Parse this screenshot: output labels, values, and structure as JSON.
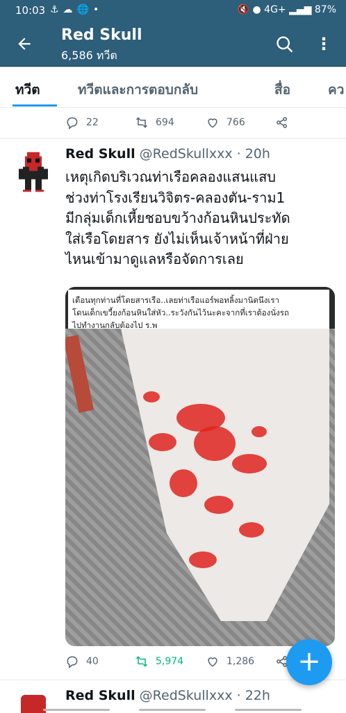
{
  "status_bar": {
    "time": "10:03",
    "left_icons": [
      "anchor-icon",
      "cloud-icon",
      "globe-icon",
      "dot-icon"
    ],
    "battery": "87%",
    "network": "4G+"
  },
  "header": {
    "title": "Red Skull",
    "subtitle": "6,586 ทวีต",
    "background": "#2d5e7a"
  },
  "tabs": [
    {
      "label": "ทวีต",
      "active": true
    },
    {
      "label": "ทวีตและการตอบกลับ",
      "active": false
    },
    {
      "label": "สื่อ",
      "active": false
    },
    {
      "label": "คว",
      "active": false
    }
  ],
  "prev_tweet": {
    "replies": "22",
    "retweets": "694",
    "likes": "766"
  },
  "tweet": {
    "name": "Red Skull",
    "handle": "@RedSkullxxx",
    "time": "· 20h",
    "lines": [
      "เหตุเกิดบริเวณท่าเรือคลองแสนแสบ",
      "ช่วงท่าโรงเรียนวิจิตร-คลองตัน-ราม1",
      "มีกลุ่มเด็กเหี้ยชอบขว้างก้อนหินประทัด",
      "ใส่เรือโดยสาร ยังไม่เห็นเจ้าหน้าที่ฝ่าย",
      "ไหนเข้ามาดูแลหรือจัดการเลย"
    ],
    "image_caption": [
      "เตือนทุกท่านที่โดยสารเรือ..เลยท่าเรือแอร์พอทลิ้งมานิดนึงเรา",
      "โดนเด็กเขวี้ยงก้อนหินใส่หัว..ระวังกันไว้นะคะจากที่เราต้องนั่งรถ",
      "ไปทำงานกลับต้องไป ร.พ"
    ],
    "replies": "40",
    "retweets": "5,974",
    "likes": "1,286",
    "retweet_color": "#00ba7c"
  },
  "next_tweet": {
    "name": "Red Skull",
    "handle": "@RedSkullxxx",
    "time": "· 22h"
  },
  "accent": "#1d9bf0"
}
